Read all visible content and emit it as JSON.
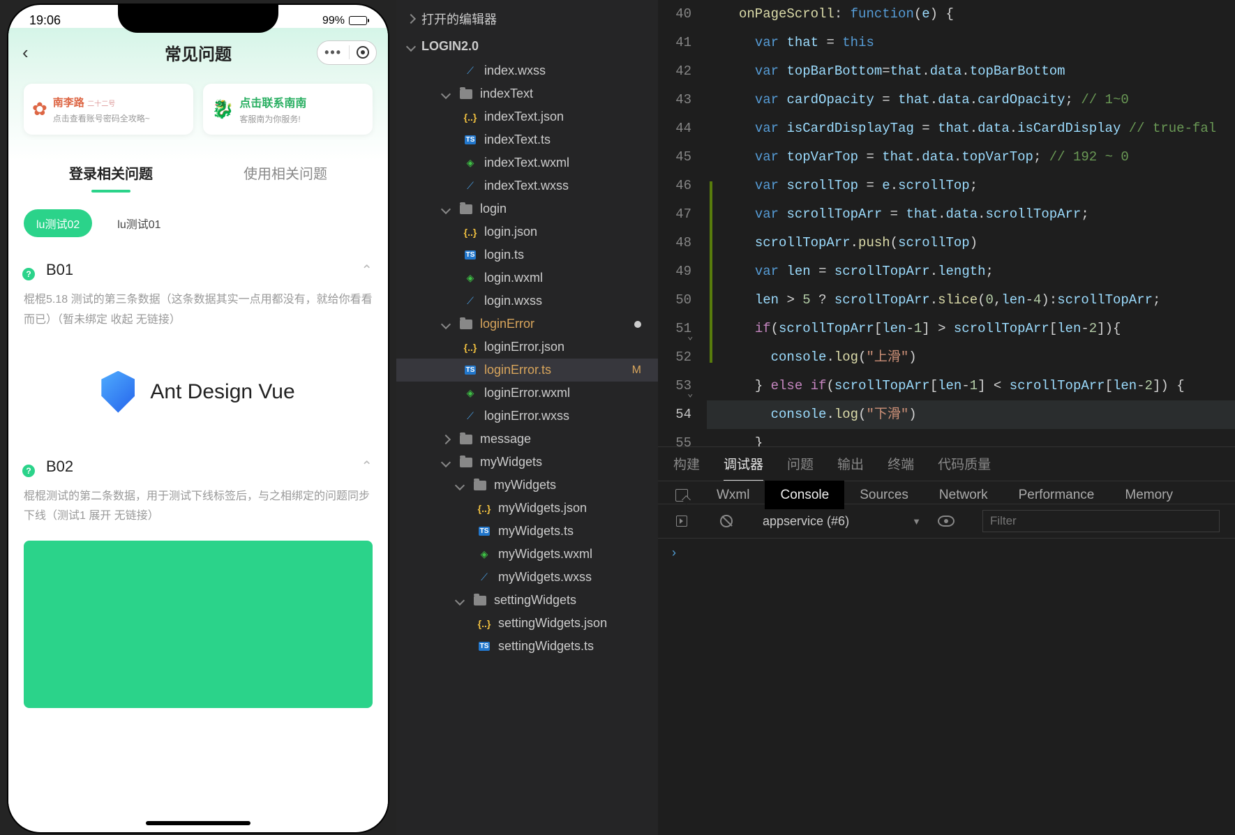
{
  "phone": {
    "status_time": "19:06",
    "battery_pct": "99%",
    "title": "常见问题",
    "card1_brand": "南李路",
    "card1_badge": "二十二号",
    "card1_sub": "点击查看账号密码全攻略~",
    "card2_title": "点击联系南南",
    "card2_sub": "客服南为你服务!",
    "tab_login": "登录相关问题",
    "tab_use": "使用相关问题",
    "chip_active": "lu测试02",
    "chip_other": "lu测试01",
    "faq1_title": "B01",
    "faq1_body": "棍棍5.18 测试的第三条数据（这条数据其实一点用都没有，就给你看看而已）（暂未绑定 收起 无链接）",
    "ant_text": "Ant Design Vue",
    "faq2_title": "B02",
    "faq2_body": "棍棍测试的第二条数据，用于测试下线标签后，与之相绑定的问题同步下线（测试1 展开 无链接）"
  },
  "explorer": {
    "opened_label": "打开的编辑器",
    "project": "LOGIN2.0",
    "items": [
      {
        "indent": 96,
        "type": "file",
        "kind": "wxss",
        "label": "index.wxss"
      },
      {
        "indent": 66,
        "type": "folder_open",
        "label": "indexText"
      },
      {
        "indent": 96,
        "type": "file",
        "kind": "json",
        "label": "indexText.json"
      },
      {
        "indent": 96,
        "type": "file",
        "kind": "ts",
        "label": "indexText.ts"
      },
      {
        "indent": 96,
        "type": "file",
        "kind": "wxml",
        "label": "indexText.wxml"
      },
      {
        "indent": 96,
        "type": "file",
        "kind": "wxss",
        "label": "indexText.wxss"
      },
      {
        "indent": 66,
        "type": "folder_open",
        "label": "login"
      },
      {
        "indent": 96,
        "type": "file",
        "kind": "json",
        "label": "login.json"
      },
      {
        "indent": 96,
        "type": "file",
        "kind": "ts",
        "label": "login.ts"
      },
      {
        "indent": 96,
        "type": "file",
        "kind": "wxml",
        "label": "login.wxml"
      },
      {
        "indent": 96,
        "type": "file",
        "kind": "wxss",
        "label": "login.wxss"
      },
      {
        "indent": 66,
        "type": "folder_open",
        "label": "loginError",
        "dot": true,
        "color": "#d8a55c"
      },
      {
        "indent": 96,
        "type": "file",
        "kind": "json",
        "label": "loginError.json"
      },
      {
        "indent": 96,
        "type": "file",
        "kind": "ts",
        "label": "loginError.ts",
        "active": true,
        "mod": "M",
        "color": "#d8a55c"
      },
      {
        "indent": 96,
        "type": "file",
        "kind": "wxml",
        "label": "loginError.wxml"
      },
      {
        "indent": 96,
        "type": "file",
        "kind": "wxss",
        "label": "loginError.wxss"
      },
      {
        "indent": 66,
        "type": "folder_closed",
        "label": "message"
      },
      {
        "indent": 66,
        "type": "folder_open",
        "label": "myWidgets"
      },
      {
        "indent": 86,
        "type": "folder_open",
        "label": "myWidgets"
      },
      {
        "indent": 116,
        "type": "file",
        "kind": "json",
        "label": "myWidgets.json"
      },
      {
        "indent": 116,
        "type": "file",
        "kind": "ts",
        "label": "myWidgets.ts"
      },
      {
        "indent": 116,
        "type": "file",
        "kind": "wxml",
        "label": "myWidgets.wxml"
      },
      {
        "indent": 116,
        "type": "file",
        "kind": "wxss",
        "label": "myWidgets.wxss"
      },
      {
        "indent": 86,
        "type": "folder_open",
        "label": "settingWidgets"
      },
      {
        "indent": 116,
        "type": "file",
        "kind": "json",
        "label": "settingWidgets.json"
      },
      {
        "indent": 116,
        "type": "file",
        "kind": "ts",
        "label": "settingWidgets.ts"
      }
    ]
  },
  "editor": {
    "line_start": 40,
    "current_line": 54,
    "lines_count": 16,
    "fold_lines": [
      51,
      53
    ]
  },
  "panel": {
    "tabs": [
      "构建",
      "调试器",
      "问题",
      "输出",
      "终端",
      "代码质量"
    ],
    "active_tab": 1,
    "devtabs": [
      "Wxml",
      "Console",
      "Sources",
      "Network",
      "Performance",
      "Memory"
    ],
    "active_dev": 1,
    "context": "appservice (#6)",
    "filter_placeholder": "Filter",
    "prompt": "›"
  }
}
